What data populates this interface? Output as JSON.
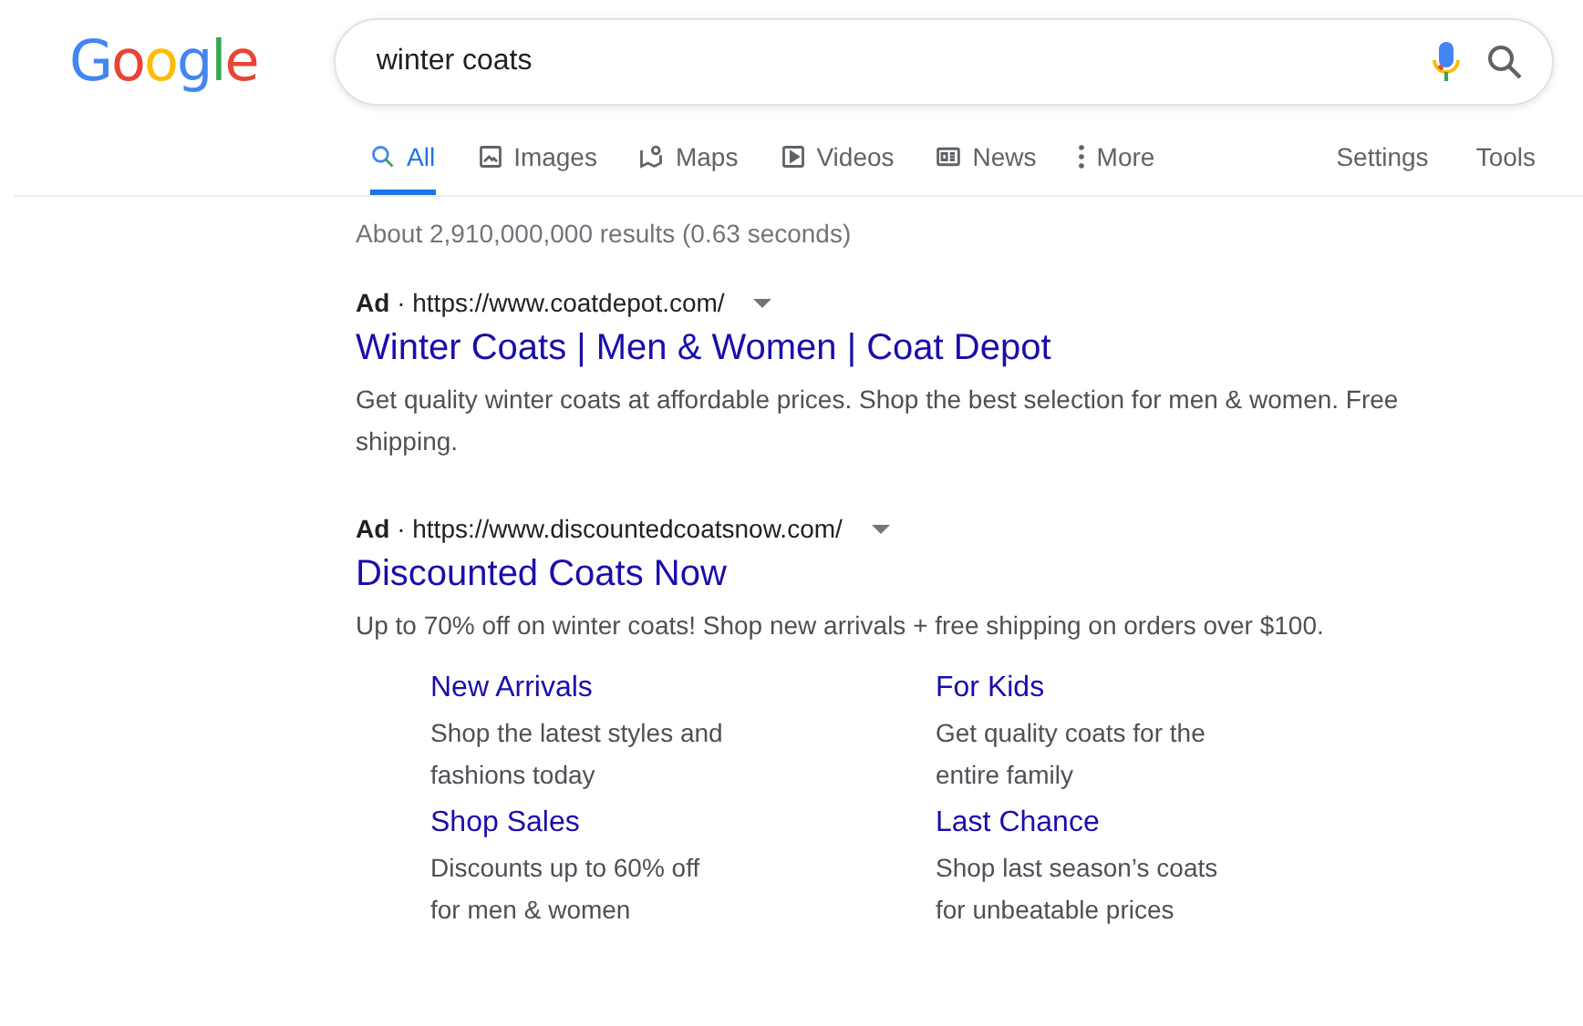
{
  "logo": {
    "text": "Google"
  },
  "search": {
    "value": "winter coats"
  },
  "tabs": [
    {
      "label": "All",
      "kind": "search",
      "selected": true
    },
    {
      "label": "Images",
      "kind": "image",
      "selected": false
    },
    {
      "label": "Maps",
      "kind": "map",
      "selected": false
    },
    {
      "label": "Videos",
      "kind": "video",
      "selected": false
    },
    {
      "label": "News",
      "kind": "news",
      "selected": false
    },
    {
      "label": "More",
      "kind": "more",
      "selected": false
    }
  ],
  "tools": [
    "Settings",
    "Tools"
  ],
  "result_stats": "About 2,910,000,000 results (0.63 seconds)",
  "ads": [
    {
      "badge": "Ad",
      "separator": "·",
      "url": "https://www.coatdepot.com/",
      "title": "Winter Coats | Men & Women | Coat Depot",
      "description": "Get quality winter coats at affordable prices. Shop the best selection for men & women. Free shipping."
    },
    {
      "badge": "Ad",
      "separator": "·",
      "url": "https://www.discountedcoatsnow.com/",
      "title": "Discounted Coats Now",
      "description": "Up to 70% off on winter coats! Shop new arrivals + free shipping on orders over $100.",
      "sitelinks": [
        {
          "title": "New Arrivals",
          "lines": [
            "Shop the latest styles and",
            "fashions today"
          ]
        },
        {
          "title": "For Kids",
          "lines": [
            "Get quality coats for the",
            "entire family"
          ]
        },
        {
          "title": "Shop Sales",
          "lines": [
            "Discounts up to 60% off",
            "for men & women"
          ]
        },
        {
          "title": "Last Chance",
          "lines": [
            "Shop last season’s coats",
            "for unbeatable prices"
          ]
        }
      ]
    }
  ]
}
